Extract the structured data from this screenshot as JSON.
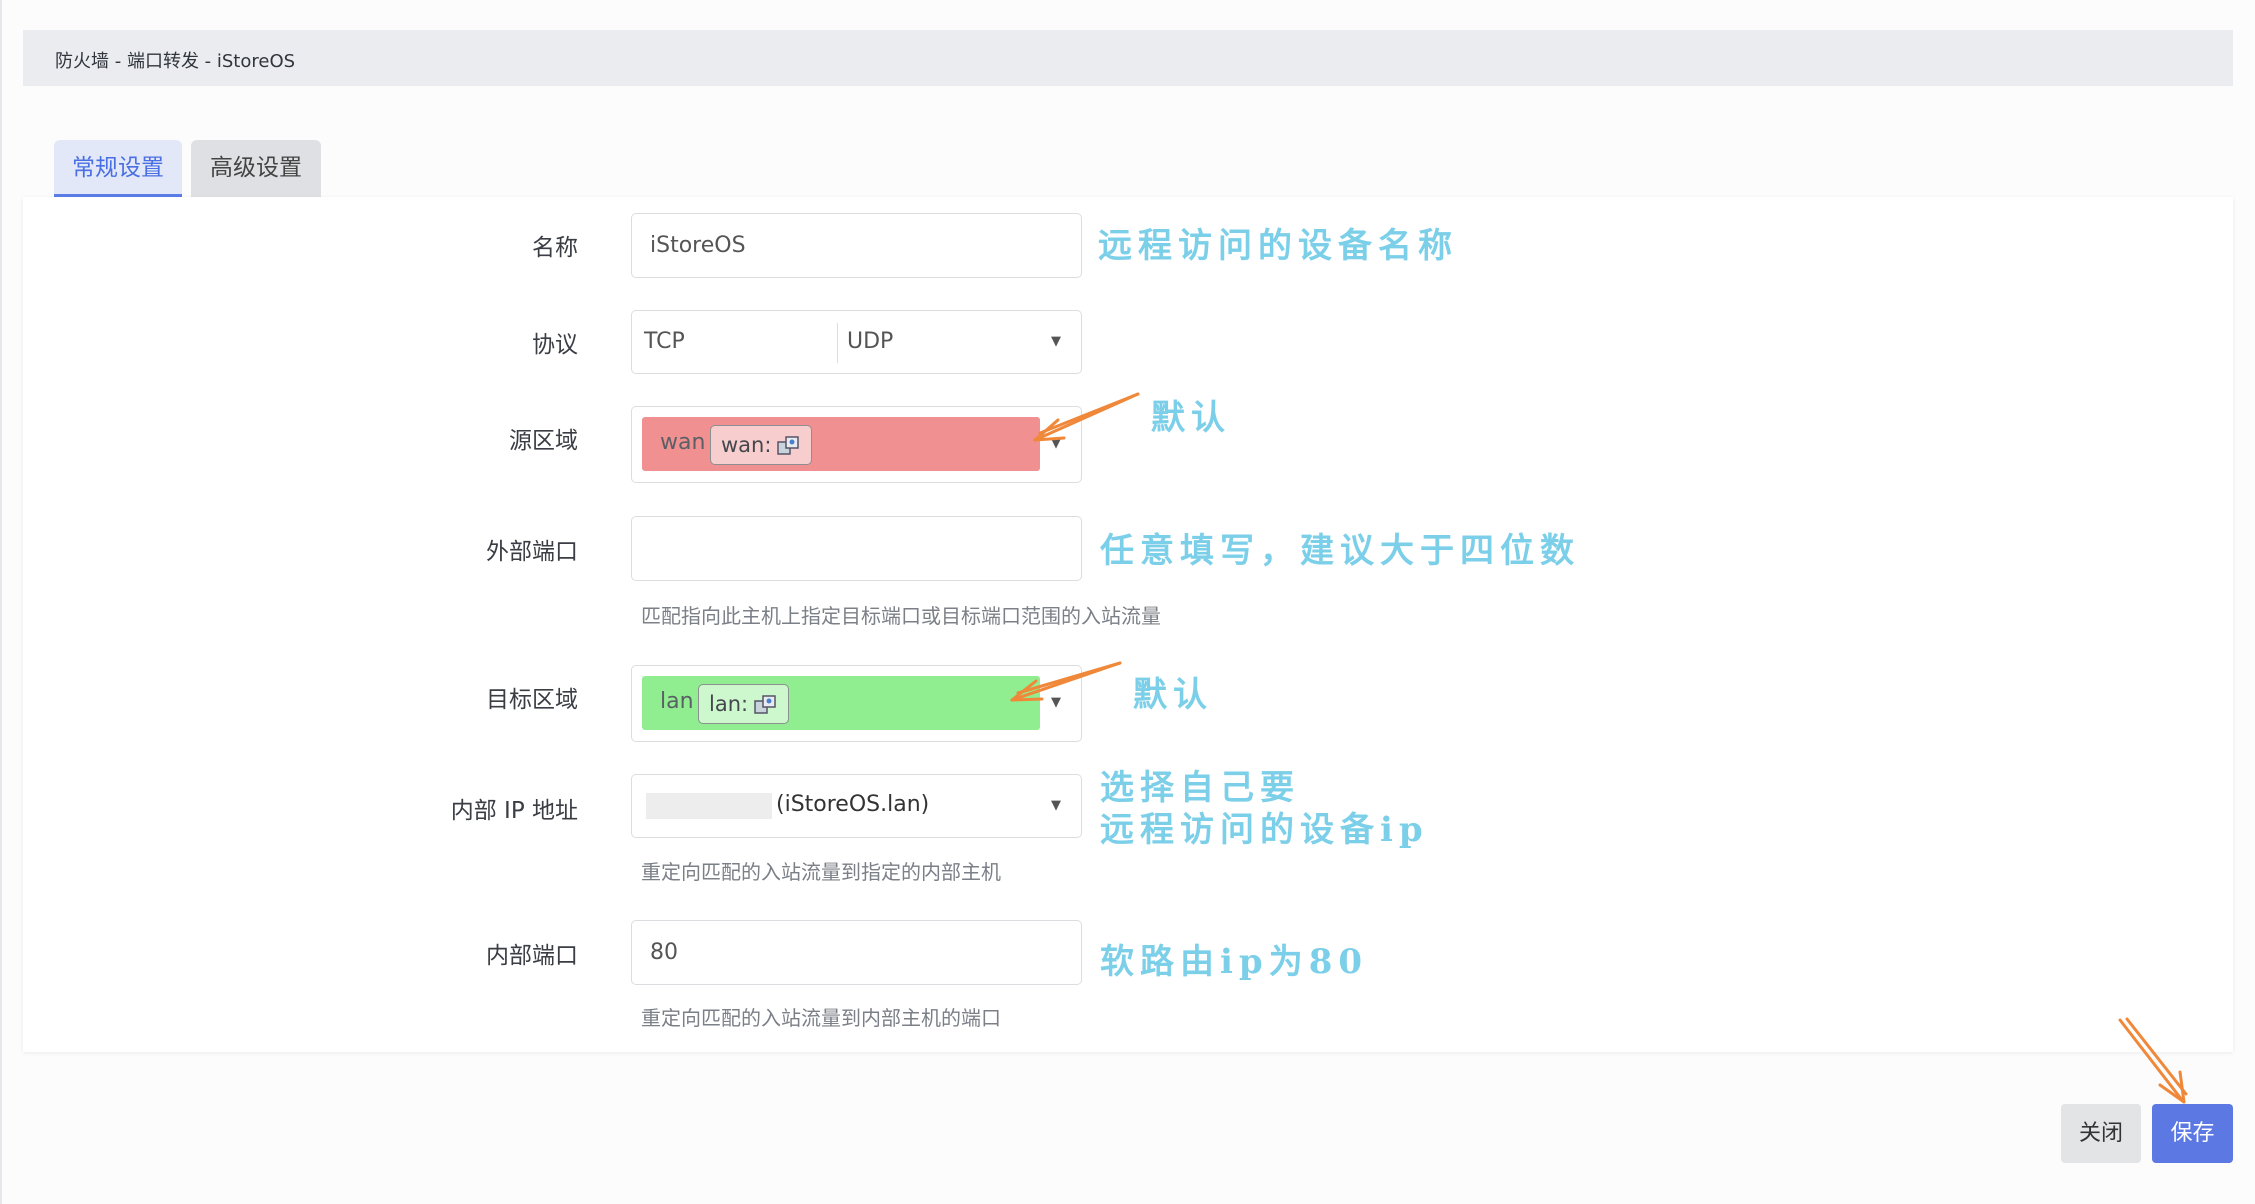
{
  "window": {
    "title": "防火墙 - 端口转发 - iStoreOS"
  },
  "tabs": [
    {
      "label": "常规设置",
      "active": true
    },
    {
      "label": "高级设置",
      "active": false
    }
  ],
  "form": {
    "name": {
      "label": "名称",
      "value": "iStoreOS"
    },
    "protocol": {
      "label": "协议",
      "values": [
        "TCP",
        "UDP"
      ]
    },
    "src_zone": {
      "label": "源区域",
      "zone": "wan",
      "chip": "wan:",
      "color": "#f09090"
    },
    "ext_port": {
      "label": "外部端口",
      "value": "",
      "help": "匹配指向此主机上指定目标端口或目标端口范围的入站流量"
    },
    "dest_zone": {
      "label": "目标区域",
      "zone": "lan",
      "chip": "lan:",
      "color": "#90ee90"
    },
    "internal_ip": {
      "label": "内部 IP 地址",
      "value_suffix": "(iStoreOS.lan)",
      "help": "重定向匹配的入站流量到指定的内部主机"
    },
    "internal_port": {
      "label": "内部端口",
      "value": "80",
      "help": "重定向匹配的入站流量到内部主机的端口"
    }
  },
  "annotations": {
    "name": "远程访问的设备名称",
    "src_zone": "默认",
    "ext_port": "任意填写，建议大于四位数",
    "dest_zone": "默认",
    "internal_ip_line1": "选择自己要",
    "internal_ip_line2": "远程访问的设备ip",
    "internal_port": "软路由ip为80"
  },
  "footer": {
    "close_label": "关闭",
    "save_label": "保存"
  },
  "colors": {
    "accent": "#5b78e3",
    "annotation": "#7ccfe8",
    "arrow": "#f0883a"
  }
}
